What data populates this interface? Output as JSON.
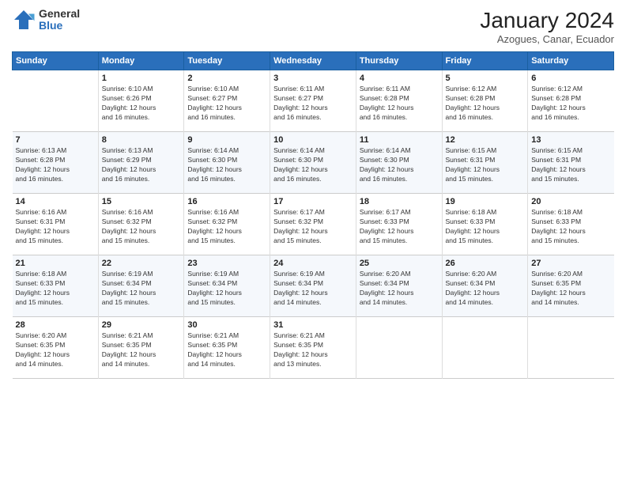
{
  "header": {
    "logo_general": "General",
    "logo_blue": "Blue",
    "month_year": "January 2024",
    "location": "Azogues, Canar, Ecuador"
  },
  "weekdays": [
    "Sunday",
    "Monday",
    "Tuesday",
    "Wednesday",
    "Thursday",
    "Friday",
    "Saturday"
  ],
  "weeks": [
    [
      {
        "day": "",
        "info": ""
      },
      {
        "day": "1",
        "info": "Sunrise: 6:10 AM\nSunset: 6:26 PM\nDaylight: 12 hours\nand 16 minutes."
      },
      {
        "day": "2",
        "info": "Sunrise: 6:10 AM\nSunset: 6:27 PM\nDaylight: 12 hours\nand 16 minutes."
      },
      {
        "day": "3",
        "info": "Sunrise: 6:11 AM\nSunset: 6:27 PM\nDaylight: 12 hours\nand 16 minutes."
      },
      {
        "day": "4",
        "info": "Sunrise: 6:11 AM\nSunset: 6:28 PM\nDaylight: 12 hours\nand 16 minutes."
      },
      {
        "day": "5",
        "info": "Sunrise: 6:12 AM\nSunset: 6:28 PM\nDaylight: 12 hours\nand 16 minutes."
      },
      {
        "day": "6",
        "info": "Sunrise: 6:12 AM\nSunset: 6:28 PM\nDaylight: 12 hours\nand 16 minutes."
      }
    ],
    [
      {
        "day": "7",
        "info": "Sunrise: 6:13 AM\nSunset: 6:28 PM\nDaylight: 12 hours\nand 16 minutes."
      },
      {
        "day": "8",
        "info": "Sunrise: 6:13 AM\nSunset: 6:29 PM\nDaylight: 12 hours\nand 16 minutes."
      },
      {
        "day": "9",
        "info": "Sunrise: 6:14 AM\nSunset: 6:30 PM\nDaylight: 12 hours\nand 16 minutes."
      },
      {
        "day": "10",
        "info": "Sunrise: 6:14 AM\nSunset: 6:30 PM\nDaylight: 12 hours\nand 16 minutes."
      },
      {
        "day": "11",
        "info": "Sunrise: 6:14 AM\nSunset: 6:30 PM\nDaylight: 12 hours\nand 16 minutes."
      },
      {
        "day": "12",
        "info": "Sunrise: 6:15 AM\nSunset: 6:31 PM\nDaylight: 12 hours\nand 15 minutes."
      },
      {
        "day": "13",
        "info": "Sunrise: 6:15 AM\nSunset: 6:31 PM\nDaylight: 12 hours\nand 15 minutes."
      }
    ],
    [
      {
        "day": "14",
        "info": "Sunrise: 6:16 AM\nSunset: 6:31 PM\nDaylight: 12 hours\nand 15 minutes."
      },
      {
        "day": "15",
        "info": "Sunrise: 6:16 AM\nSunset: 6:32 PM\nDaylight: 12 hours\nand 15 minutes."
      },
      {
        "day": "16",
        "info": "Sunrise: 6:16 AM\nSunset: 6:32 PM\nDaylight: 12 hours\nand 15 minutes."
      },
      {
        "day": "17",
        "info": "Sunrise: 6:17 AM\nSunset: 6:32 PM\nDaylight: 12 hours\nand 15 minutes."
      },
      {
        "day": "18",
        "info": "Sunrise: 6:17 AM\nSunset: 6:33 PM\nDaylight: 12 hours\nand 15 minutes."
      },
      {
        "day": "19",
        "info": "Sunrise: 6:18 AM\nSunset: 6:33 PM\nDaylight: 12 hours\nand 15 minutes."
      },
      {
        "day": "20",
        "info": "Sunrise: 6:18 AM\nSunset: 6:33 PM\nDaylight: 12 hours\nand 15 minutes."
      }
    ],
    [
      {
        "day": "21",
        "info": "Sunrise: 6:18 AM\nSunset: 6:33 PM\nDaylight: 12 hours\nand 15 minutes."
      },
      {
        "day": "22",
        "info": "Sunrise: 6:19 AM\nSunset: 6:34 PM\nDaylight: 12 hours\nand 15 minutes."
      },
      {
        "day": "23",
        "info": "Sunrise: 6:19 AM\nSunset: 6:34 PM\nDaylight: 12 hours\nand 15 minutes."
      },
      {
        "day": "24",
        "info": "Sunrise: 6:19 AM\nSunset: 6:34 PM\nDaylight: 12 hours\nand 14 minutes."
      },
      {
        "day": "25",
        "info": "Sunrise: 6:20 AM\nSunset: 6:34 PM\nDaylight: 12 hours\nand 14 minutes."
      },
      {
        "day": "26",
        "info": "Sunrise: 6:20 AM\nSunset: 6:34 PM\nDaylight: 12 hours\nand 14 minutes."
      },
      {
        "day": "27",
        "info": "Sunrise: 6:20 AM\nSunset: 6:35 PM\nDaylight: 12 hours\nand 14 minutes."
      }
    ],
    [
      {
        "day": "28",
        "info": "Sunrise: 6:20 AM\nSunset: 6:35 PM\nDaylight: 12 hours\nand 14 minutes."
      },
      {
        "day": "29",
        "info": "Sunrise: 6:21 AM\nSunset: 6:35 PM\nDaylight: 12 hours\nand 14 minutes."
      },
      {
        "day": "30",
        "info": "Sunrise: 6:21 AM\nSunset: 6:35 PM\nDaylight: 12 hours\nand 14 minutes."
      },
      {
        "day": "31",
        "info": "Sunrise: 6:21 AM\nSunset: 6:35 PM\nDaylight: 12 hours\nand 13 minutes."
      },
      {
        "day": "",
        "info": ""
      },
      {
        "day": "",
        "info": ""
      },
      {
        "day": "",
        "info": ""
      }
    ]
  ]
}
